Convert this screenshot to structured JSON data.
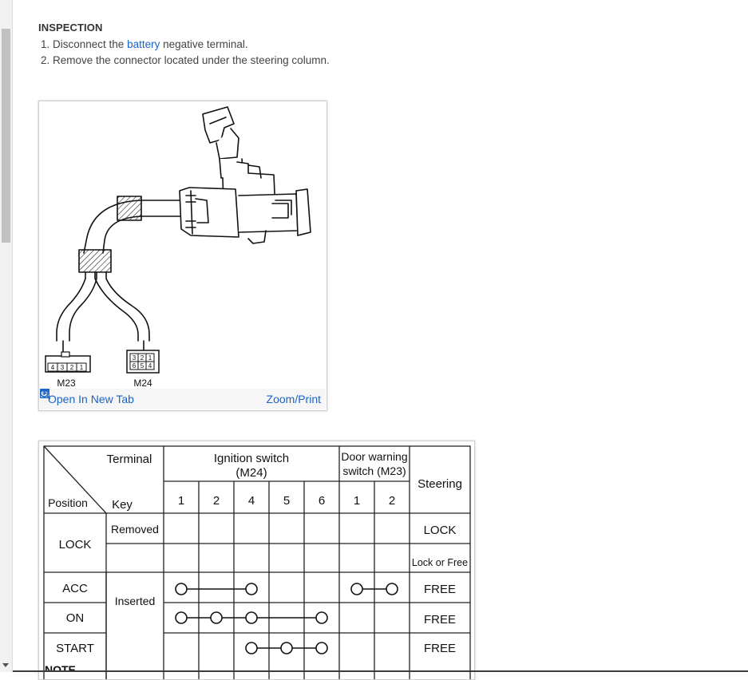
{
  "section": {
    "heading": "INSPECTION",
    "steps": [
      {
        "prefix": "Disconnect the ",
        "link": "battery",
        "suffix": " negative terminal."
      },
      {
        "text": "Remove the connector located under the steering column."
      }
    ]
  },
  "figure": {
    "connector_left_label": "M23",
    "connector_right_label": "M24",
    "m23_pins": [
      "4",
      "3",
      "2",
      "1"
    ],
    "m24_pins_top": [
      "3",
      "2",
      "1"
    ],
    "m24_pins_bottom": [
      "6",
      "5",
      "4"
    ],
    "open_tab_label": "Open In New Tab",
    "zoom_label": "Zoom/Print"
  },
  "table": {
    "header_terminal": "Terminal",
    "header_position": "Position",
    "header_key": "Key",
    "header_ignition_line1": "Ignition switch",
    "header_ignition_line2": "(M24)",
    "header_door_line1": "Door warning",
    "header_door_line2": "switch (M23)",
    "header_steering": "Steering",
    "ignition_terminals": [
      "1",
      "2",
      "4",
      "5",
      "6"
    ],
    "door_terminals": [
      "1",
      "2"
    ],
    "pos_lock": "LOCK",
    "pos_acc": "ACC",
    "pos_on": "ON",
    "pos_start": "START",
    "key_removed": "Removed",
    "key_inserted": "Inserted",
    "steer_lock": "LOCK",
    "steer_lock_or_free": "Lock or Free",
    "steer_acc": "FREE",
    "steer_on": "FREE",
    "steer_start": "FREE",
    "continuity": {
      "acc": {
        "ignition": [
          "1",
          "4"
        ],
        "door": [
          "1",
          "2"
        ]
      },
      "on": {
        "ignition": [
          "1",
          "2",
          "4",
          "6"
        ]
      },
      "start": {
        "ignition": [
          "4",
          "5",
          "6"
        ]
      }
    }
  },
  "note_peek": "NOTE"
}
